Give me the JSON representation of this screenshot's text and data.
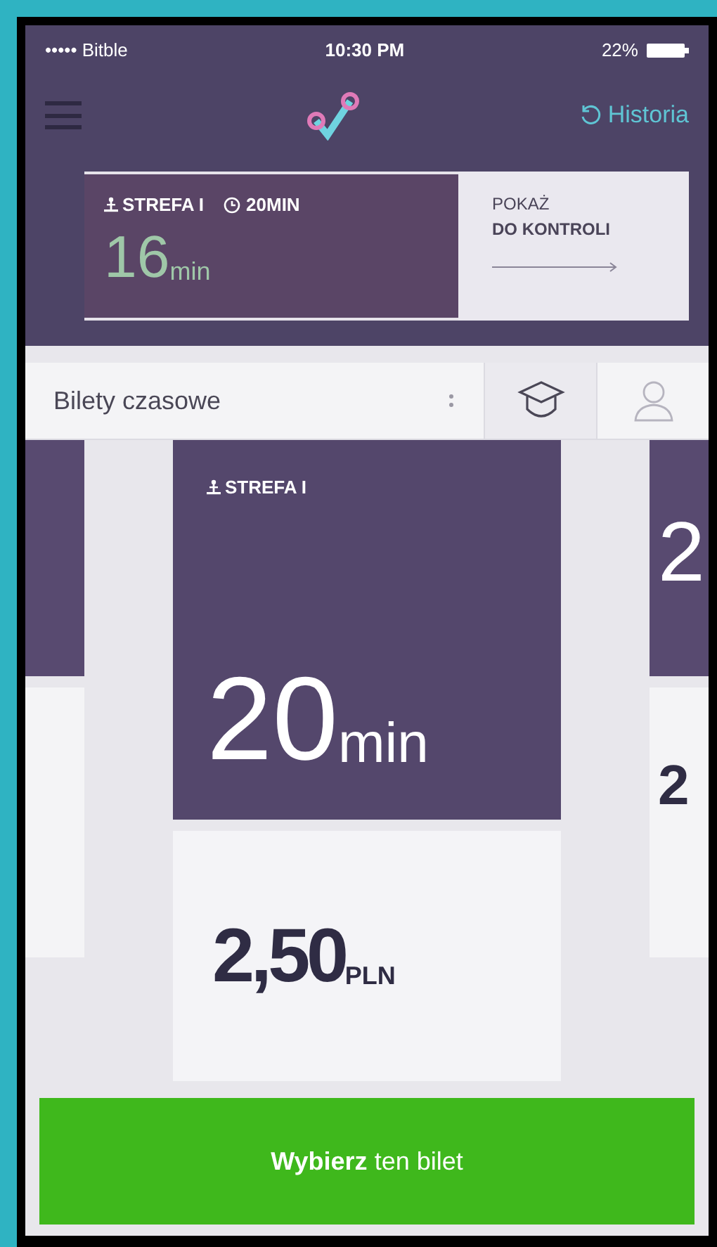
{
  "status_bar": {
    "carrier": "••••• Bitble",
    "time": "10:30 PM",
    "battery": "22%"
  },
  "header": {
    "history_link": "Historia"
  },
  "active_ticket": {
    "zone": "STREFA I",
    "duration": "20MIN",
    "remaining": "16",
    "remaining_unit": "min",
    "show_label": "POKAŻ",
    "show_action": "DO KONTROLI"
  },
  "ticket_type_select": {
    "value": "Bilety czasowe"
  },
  "discount_options": [
    {
      "kind": "student",
      "selected": true
    },
    {
      "kind": "person",
      "selected": false
    }
  ],
  "tickets": [
    {
      "zone": "STREFA I",
      "duration": "20",
      "duration_unit": "min",
      "price": "2,50",
      "currency": "PLN"
    }
  ],
  "next_ticket": {
    "duration_partial": "2",
    "price_partial": "2"
  },
  "select_button": {
    "label": "**Wybierz** ten bilet"
  }
}
